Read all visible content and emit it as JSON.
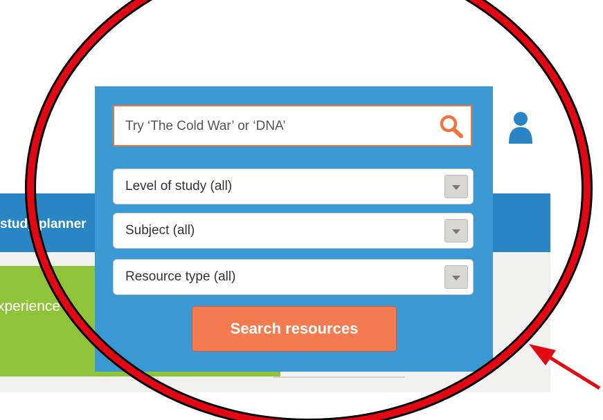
{
  "nav": {
    "text": "study planner"
  },
  "hero": {
    "text": "Experience"
  },
  "search": {
    "placeholder": "Try ‘The Cold War’ or ‘DNA’",
    "button_label": "Search resources"
  },
  "filters": {
    "level": "Level of study (all)",
    "subject": "Subject (all)",
    "resource_type": "Resource type (all)"
  },
  "colors": {
    "nav_blue": "#2a85c4",
    "panel_blue": "#3a98d3",
    "accent_orange": "#f47b4f",
    "green": "#8fc43a",
    "annotation_red": "#e30613"
  },
  "icons": {
    "search": "search-icon",
    "user": "user-icon",
    "dropdown": "chevron-down-icon"
  }
}
